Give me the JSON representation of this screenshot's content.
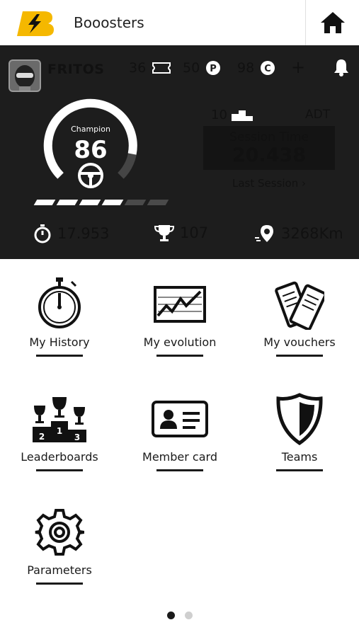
{
  "header": {
    "title": "Booosters"
  },
  "user": {
    "name": "FRITOS"
  },
  "stats": {
    "tickets": "36",
    "points": "50",
    "credits": "98",
    "add": "+"
  },
  "gauge": {
    "label": "Champion",
    "value": "86",
    "progress_segments_filled": 4,
    "progress_segments_total": 6
  },
  "ranking": {
    "podium_count": "10",
    "category": "ADT"
  },
  "session": {
    "title": "Session Time",
    "value": "20.438",
    "last_label": "Last Session"
  },
  "bottom_stats": {
    "best_lap": "17.953",
    "trophies": "107",
    "distance": "3268Km"
  },
  "menu": [
    {
      "label": "My History"
    },
    {
      "label": "My evolution"
    },
    {
      "label": "My vouchers"
    },
    {
      "label": "Leaderboards"
    },
    {
      "label": "Member card"
    },
    {
      "label": "Teams"
    },
    {
      "label": "Parameters"
    }
  ],
  "pager": {
    "active": 0,
    "count": 2
  },
  "colors": {
    "accent": "#f5b800",
    "panel": "#1d1d1d"
  }
}
